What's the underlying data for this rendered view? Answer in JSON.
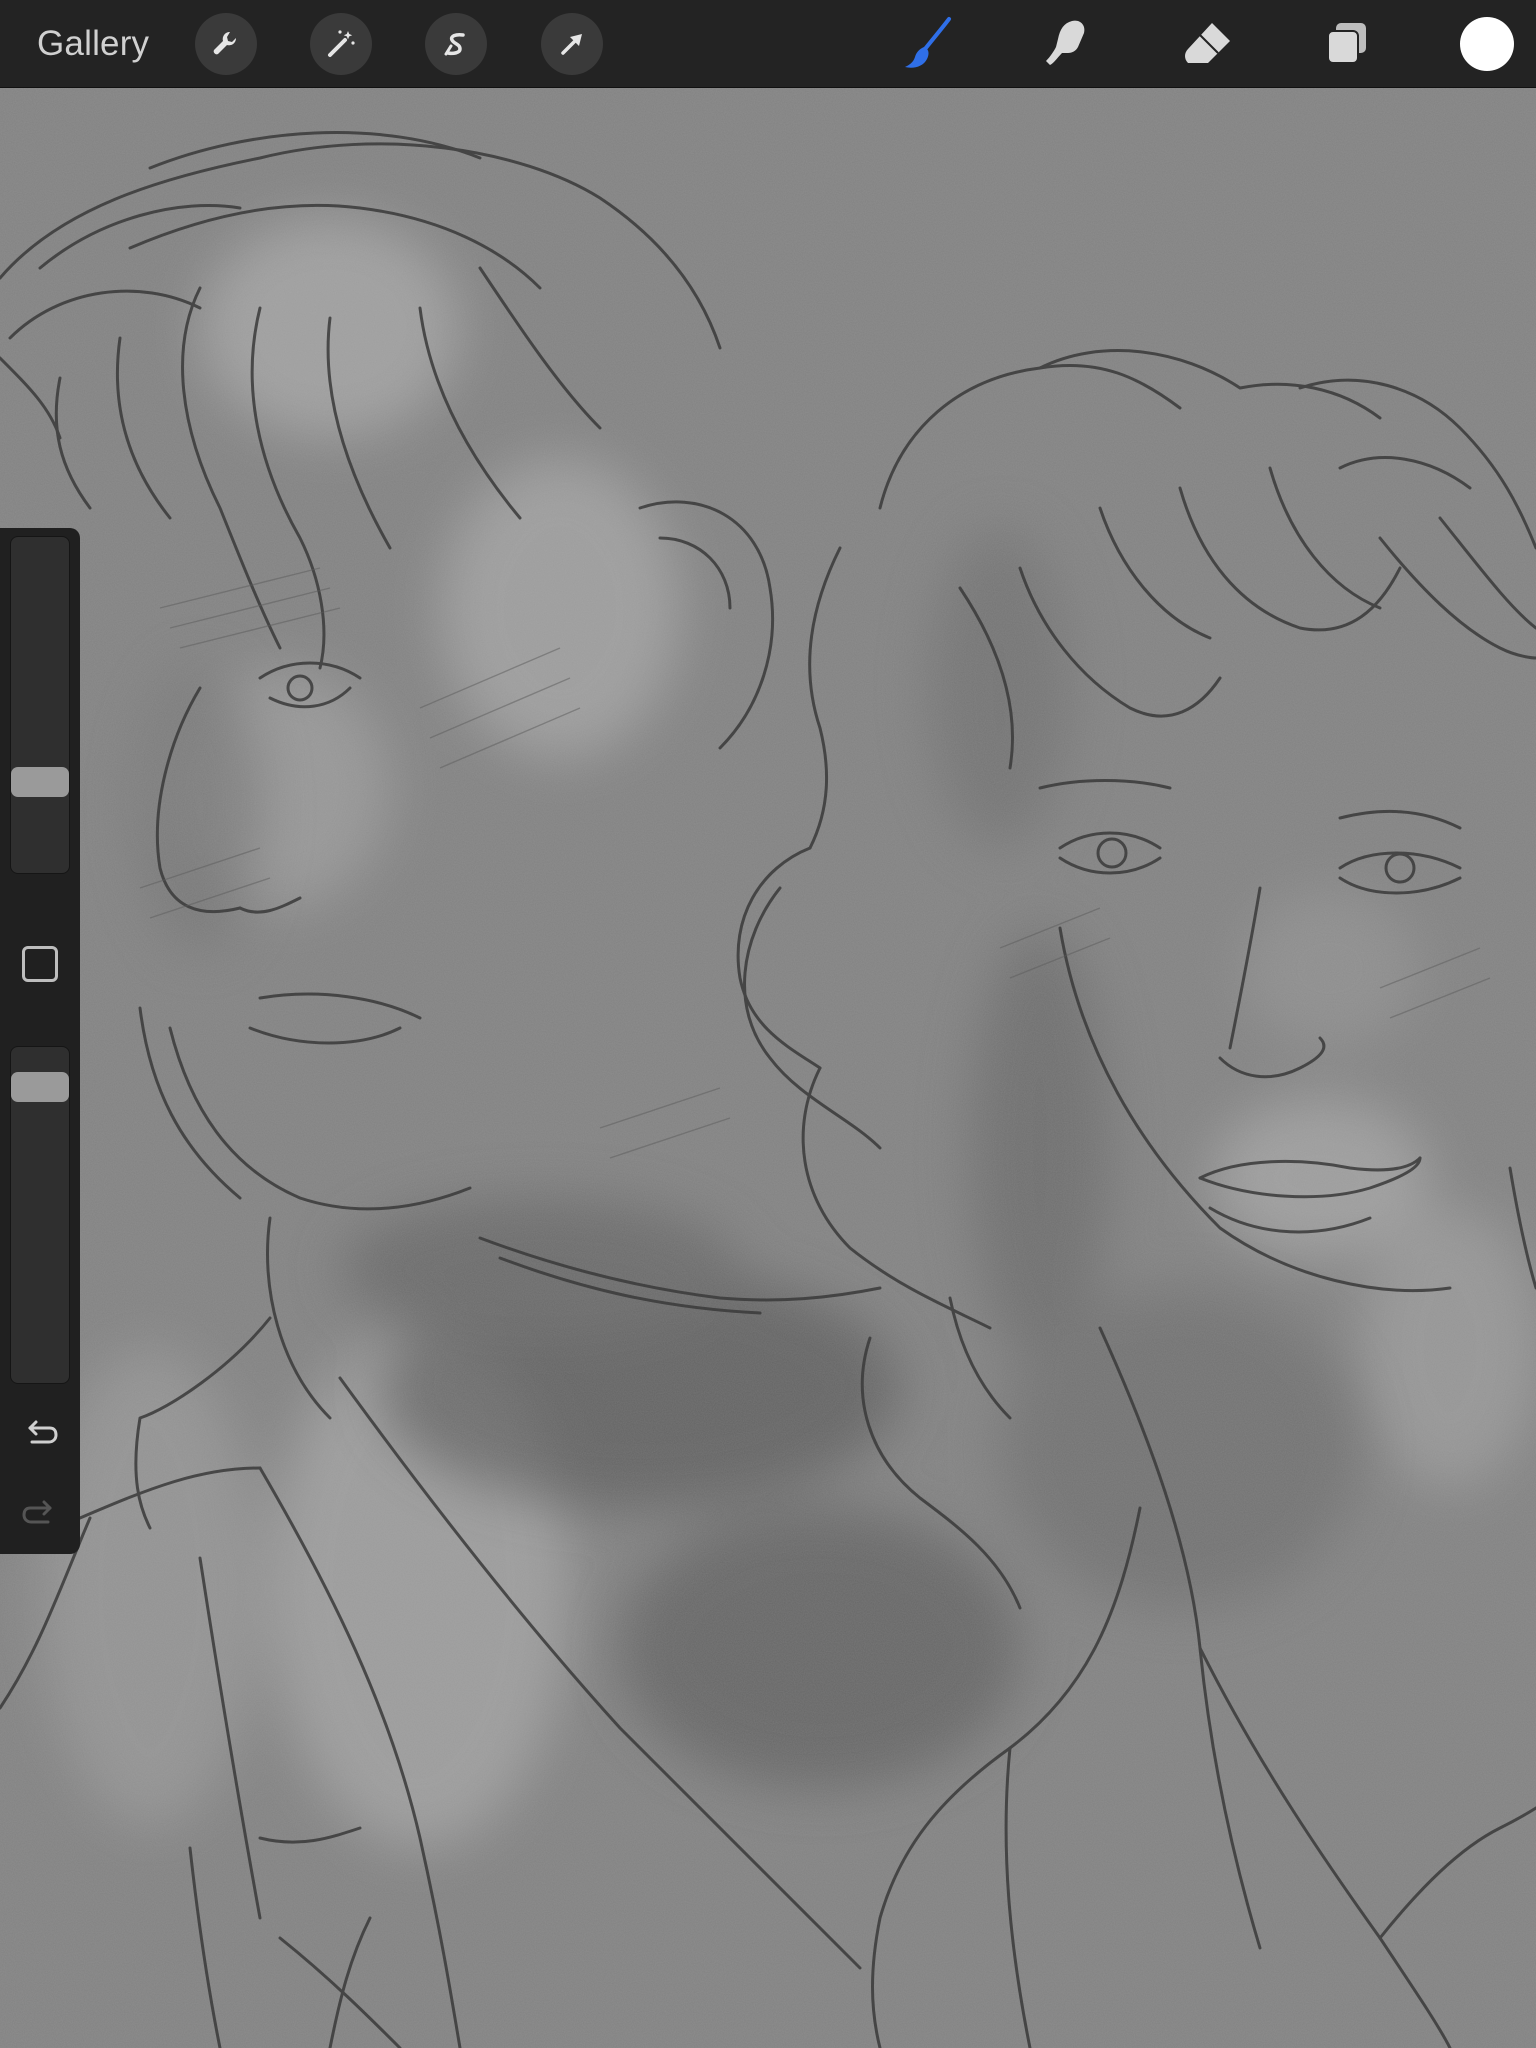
{
  "toolbar": {
    "gallery_label": "Gallery",
    "left_tools": [
      {
        "name": "actions",
        "icon": "wrench-icon"
      },
      {
        "name": "adjustments",
        "icon": "magic-wand-icon"
      },
      {
        "name": "selection",
        "icon": "selection-s-icon"
      },
      {
        "name": "transform",
        "icon": "arrow-cursor-icon"
      }
    ],
    "right_tools": [
      {
        "name": "brush",
        "icon": "brush-icon",
        "active": true
      },
      {
        "name": "smudge",
        "icon": "smudge-finger-icon",
        "active": false
      },
      {
        "name": "eraser",
        "icon": "eraser-icon",
        "active": false
      },
      {
        "name": "layers",
        "icon": "layers-icon",
        "active": false
      }
    ],
    "current_color": "#ffffff",
    "accent_color": "#2f6fe8"
  },
  "sidebar": {
    "brush_size_level": 0.24,
    "opacity_level": 0.93,
    "modify_button_icon": "square-icon",
    "undo_icon": "undo-arrow-icon",
    "redo_icon": "redo-arrow-icon"
  }
}
